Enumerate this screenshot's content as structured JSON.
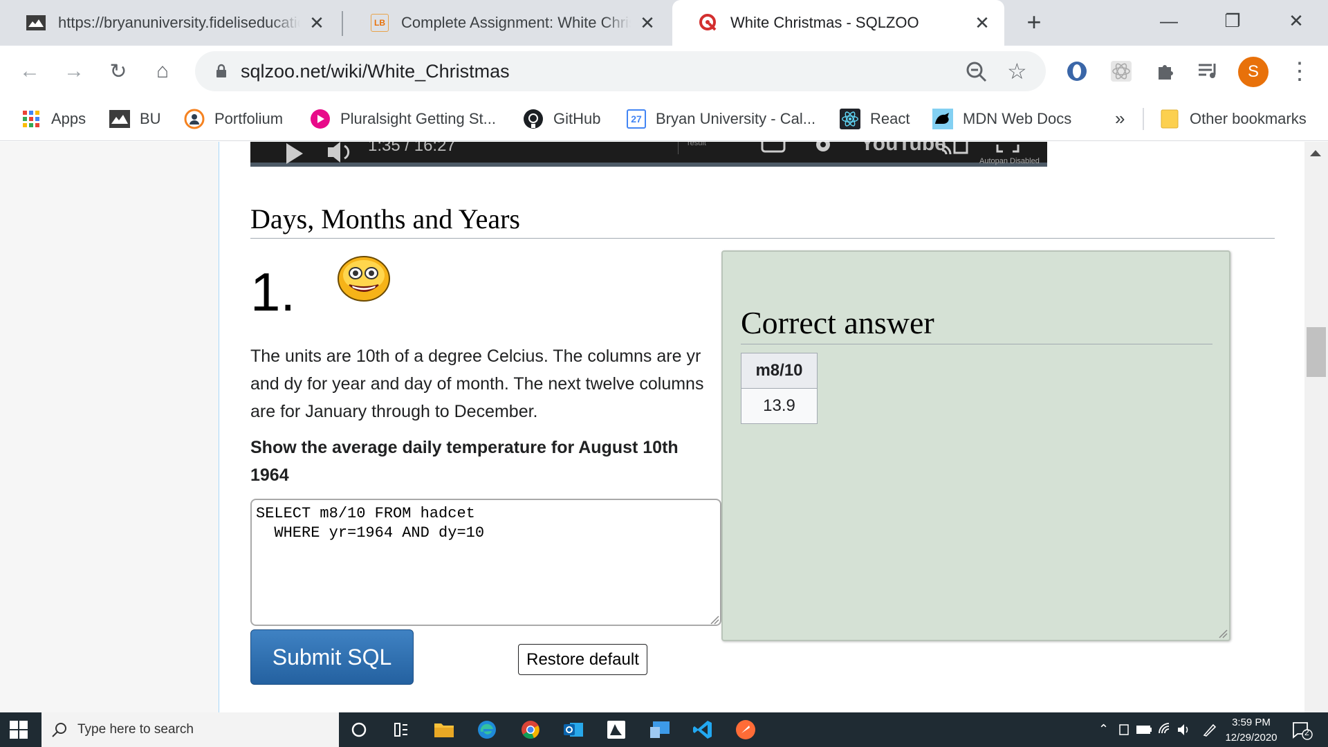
{
  "browser": {
    "tabs": [
      {
        "title": "https://bryanuniversity.fideliseducation",
        "close": "✕",
        "favicon": "bryan-university-logo"
      },
      {
        "title": "Complete Assignment: White Christmas",
        "close": "✕",
        "favicon": "lb-logo",
        "favicon_text": "LB"
      },
      {
        "title": "White Christmas - SQLZOO",
        "close": "✕",
        "favicon": "sqlzoo-logo",
        "active": true
      }
    ],
    "new_tab": "+",
    "window_controls": {
      "minimize": "—",
      "restore": "❐",
      "close": "✕"
    },
    "nav": {
      "back": "←",
      "forward": "→",
      "reload": "↻",
      "home": "⌂"
    },
    "url": "sqlzoo.net/wiki/White_Christmas",
    "star": "☆",
    "profile_letter": "S",
    "menu": "⋮"
  },
  "bookmarks": {
    "items": [
      {
        "label": "Apps",
        "icon": "apps-grid-icon"
      },
      {
        "label": "BU",
        "icon": "bryan-university-logo"
      },
      {
        "label": "Portfolium",
        "icon": "portfolium-icon"
      },
      {
        "label": "Pluralsight Getting St...",
        "icon": "pluralsight-icon"
      },
      {
        "label": "GitHub",
        "icon": "github-icon"
      },
      {
        "label": "Bryan University - Cal...",
        "icon": "calendar-icon",
        "icon_text": "27"
      },
      {
        "label": "React",
        "icon": "react-icon"
      },
      {
        "label": "MDN Web Docs",
        "icon": "mdn-icon"
      }
    ],
    "more": "»",
    "other": "Other bookmarks"
  },
  "video": {
    "time": "1:35 / 16:27",
    "brand": "YouTube",
    "autopan": "Autopan Disabled",
    "result_label": "result"
  },
  "page": {
    "section_title": "Days, Months and Years",
    "question_number": "1.",
    "question_text": "The units are 10th of a degree Celcius. The columns are yr and dy for year and day of month. The next twelve columns are for January through to December.",
    "task": "Show the average daily temperature for August 10th 1964",
    "sql": "SELECT m8/10 FROM hadcet\n  WHERE yr=1964 AND dy=10",
    "submit_label": "Submit SQL",
    "restore_label": "Restore default",
    "answer": {
      "title": "Correct answer",
      "columns": [
        "m8/10"
      ],
      "rows": [
        [
          "13.9"
        ]
      ]
    }
  },
  "taskbar": {
    "search_placeholder": "Type here to search",
    "time": "3:59 PM",
    "date": "12/29/2020",
    "notification_count": "2"
  },
  "colors": {
    "answer_bg": "#d5e1d5",
    "submit_bg": "#2a6aab",
    "profile_bg": "#e8710a",
    "taskbar_bg": "#1f2b33"
  }
}
